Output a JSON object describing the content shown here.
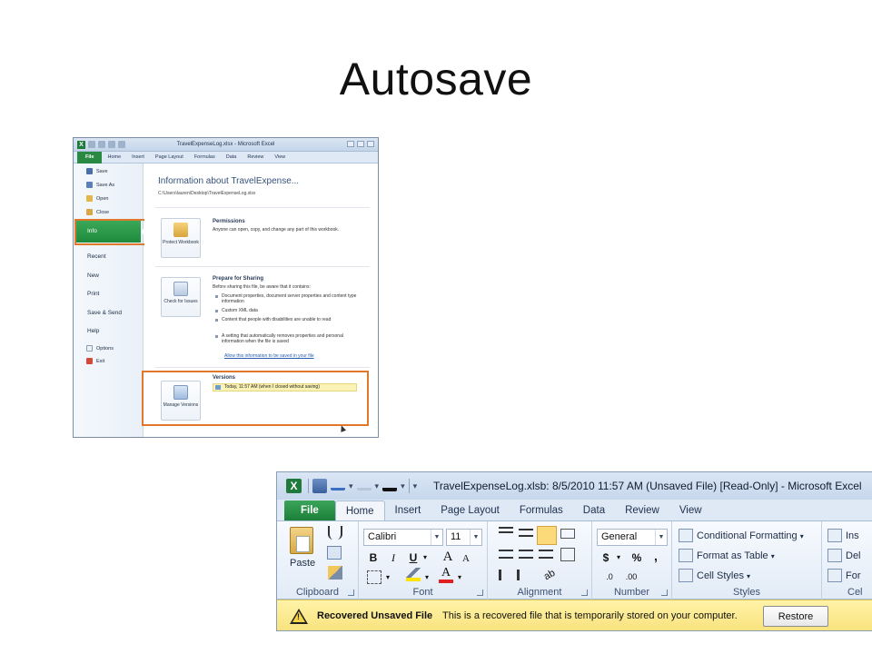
{
  "slide": {
    "title": "Autosave"
  },
  "backstage": {
    "window_title": "TravelExpenseLog.xlsx - Microsoft Excel",
    "tabs": [
      "File",
      "Home",
      "Insert",
      "Page Layout",
      "Formulas",
      "Data",
      "Review",
      "View"
    ],
    "menu": {
      "save": "Save",
      "save_as": "Save As",
      "open": "Open",
      "close": "Close",
      "info": "Info",
      "recent": "Recent",
      "new": "New",
      "print": "Print",
      "save_send": "Save & Send",
      "help": "Help",
      "options": "Options",
      "exit": "Exit"
    },
    "heading": "Information about TravelExpense...",
    "path": "C:\\Users\\lauren\\Desktop\\TravelExpenseLog.xlsx",
    "permissions": {
      "button": "Protect Workbook",
      "title": "Permissions",
      "text": "Anyone can open, copy, and change any part of this workbook."
    },
    "sharing": {
      "button": "Check for Issues",
      "title": "Prepare for Sharing",
      "text": "Before sharing this file, be aware that it contains:",
      "bullets": [
        "Document properties, document server properties and content type information",
        "Custom XML data",
        "Content that people with disabilities are unable to read",
        "A setting that automatically removes properties and personal information when the file is saved"
      ],
      "link": "Allow this information to be saved in your file"
    },
    "versions": {
      "button": "Manage Versions",
      "title": "Versions",
      "entry": "Today, 11:57 AM (when I closed without saving)"
    }
  },
  "excel": {
    "window_title": "TravelExpenseLog.xlsb: 8/5/2010 11:57 AM (Unsaved File)  [Read-Only]  -  Microsoft Excel",
    "tabs": {
      "file": "File",
      "home": "Home",
      "insert": "Insert",
      "page_layout": "Page Layout",
      "formulas": "Formulas",
      "data": "Data",
      "review": "Review",
      "view": "View"
    },
    "clipboard": {
      "paste": "Paste",
      "label": "Clipboard"
    },
    "font": {
      "name": "Calibri",
      "size": "11",
      "bold": "B",
      "italic": "I",
      "underline": "U",
      "grow": "A",
      "shrink": "A",
      "label": "Font"
    },
    "alignment": {
      "label": "Alignment"
    },
    "number": {
      "format": "General",
      "currency": "$",
      "percent": "%",
      "comma": ",",
      "inc_decimal": ".0",
      "dec_decimal": ".00",
      "label": "Number"
    },
    "styles": {
      "conditional": "Conditional Formatting",
      "format_table": "Format as Table",
      "cell_styles": "Cell Styles",
      "label": "Styles"
    },
    "cells": {
      "insert": "Ins",
      "delete": "Del",
      "format": "For",
      "label": "Cel"
    },
    "bar": {
      "title": "Recovered Unsaved File",
      "message": "This is a recovered file that is temporarily stored on your computer.",
      "restore": "Restore"
    },
    "colors": {
      "file_tab": "#1d7f38",
      "bar_bg": "#f9e27c"
    }
  }
}
